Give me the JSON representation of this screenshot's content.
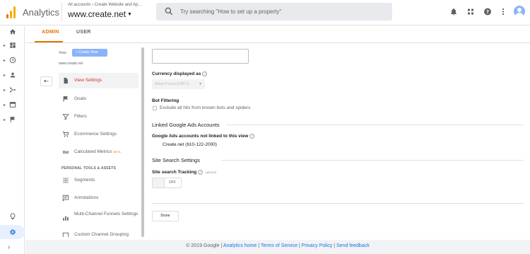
{
  "header": {
    "app_title": "Analytics",
    "breadcrumb": "All accounts › Create Website and Ap...",
    "account_name": "www.create.net",
    "search_placeholder": "Try searching \"How to set up a property\""
  },
  "tabs": [
    {
      "label": "ADMIN",
      "active": true
    },
    {
      "label": "USER",
      "active": false
    }
  ],
  "view_column": {
    "header": "View",
    "create_button": "+ Create View",
    "view_name": "www.create.net"
  },
  "menu": {
    "items": [
      {
        "label": "View Settings",
        "icon": "document-icon",
        "active": true
      },
      {
        "label": "Goals",
        "icon": "flag-icon"
      },
      {
        "label": "Filters",
        "icon": "filter-icon"
      },
      {
        "label": "Ecommerce Settings",
        "icon": "cart-icon"
      },
      {
        "label": "Calculated Metrics",
        "icon": "dd-icon",
        "badge": "BETA"
      }
    ],
    "section": "PERSONAL TOOLS & ASSETS",
    "tools": [
      {
        "label": "Segments",
        "icon": "segments-icon"
      },
      {
        "label": "Annotations",
        "icon": "annotations-icon"
      },
      {
        "label": "Multi-Channel Funnels Settings",
        "icon": "chart-icon"
      },
      {
        "label": "Custom Channel Grouping",
        "icon": "grouping-icon"
      }
    ]
  },
  "settings": {
    "currency_label": "Currency displayed as",
    "currency_value": "British Pound (GBP £)",
    "bot_filtering_label": "Bot Filtering",
    "bot_filtering_checkbox": "Exclude all hits from known bots and spiders",
    "bot_filtering_checked": false,
    "linked_ads_title": "Linked Google Ads Accounts",
    "ads_not_linked_label": "Google Ads accounts not linked to this view",
    "ads_account": "Create.net (610-122-2000)",
    "site_search_title": "Site Search Settings",
    "site_search_label": "Site search Tracking",
    "site_search_optional": "optional",
    "toggle_state": "OFF",
    "done_label": "Done",
    "help_glyph": "?"
  },
  "footer": {
    "copyright": "© 2019 Google",
    "sep": " | ",
    "links": [
      "Analytics home",
      "Terms of Service",
      "Privacy Policy",
      "Send feedback"
    ]
  },
  "colors": {
    "accent": "#e37400",
    "active_text": "#d93025",
    "link": "#1a73e8",
    "create_button": "#8ab4f8"
  }
}
